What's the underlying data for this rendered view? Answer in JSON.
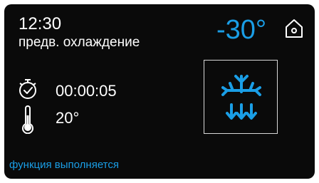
{
  "header": {
    "time": "12:30",
    "mode": "предв. охлаждение",
    "target_temp": "-30°"
  },
  "timer": {
    "value": "00:00:05"
  },
  "probe": {
    "value": "20°"
  },
  "status_text": "функция выполняется",
  "icons": {
    "home": "home-icon",
    "timer": "stopwatch-icon",
    "probe": "thermometer-icon",
    "function": "snowflake-fan-icon"
  },
  "colors": {
    "background": "#0a0a0a",
    "accent": "#1a9ee6",
    "text": "#ffffff"
  }
}
